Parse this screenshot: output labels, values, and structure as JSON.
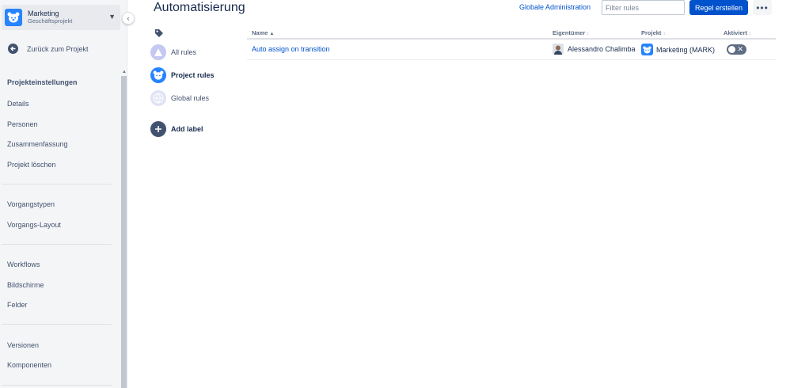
{
  "sidebar": {
    "project_name": "Marketing",
    "project_type": "Geschäftsprojekt",
    "back_label": "Zurück zum Projekt",
    "heading": "Projekteinstellungen",
    "items": [
      {
        "label": "Details"
      },
      {
        "label": "Personen"
      },
      {
        "label": "Zusammenfassung"
      },
      {
        "label": "Projekt löschen"
      },
      {
        "label": "Vorgangstypen"
      },
      {
        "label": "Vorgangs-Layout"
      },
      {
        "label": "Workflows"
      },
      {
        "label": "Bildschirme"
      },
      {
        "label": "Felder"
      },
      {
        "label": "Versionen"
      },
      {
        "label": "Komponenten"
      }
    ]
  },
  "header": {
    "title": "Automatisierung",
    "global_admin": "Globale Administration",
    "filter_placeholder": "Filter rules",
    "create_button": "Regel erstellen",
    "more_icon": "ellipsis-icon"
  },
  "labels": {
    "all_rules": "All rules",
    "project_rules": "Project rules",
    "global_rules": "Global rules",
    "add_label": "Add label"
  },
  "table": {
    "columns": {
      "name": "Name",
      "owner": "Eigentümer",
      "project": "Projekt",
      "enabled": "Aktiviert"
    },
    "rows": [
      {
        "name": "Auto assign on transition",
        "owner": "Alessandro Chalimba",
        "project": "Marketing (MARK)",
        "enabled": false
      }
    ]
  },
  "colors": {
    "accent": "#0052cc",
    "project_avatar": "#2684ff",
    "toggle_off": "#5e6c84"
  }
}
